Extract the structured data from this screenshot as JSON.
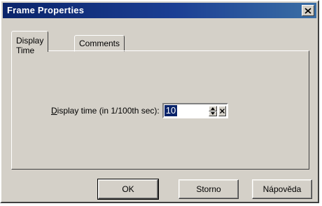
{
  "window": {
    "title": "Frame Properties"
  },
  "tabs": [
    {
      "label": "Display Time",
      "active": true
    },
    {
      "label": "Comments",
      "active": false
    }
  ],
  "display_time": {
    "label_mnemonic": "D",
    "label_rest": "isplay time (in 1/100th sec):",
    "value": "10"
  },
  "buttons": {
    "ok": "OK",
    "cancel": "Storno",
    "help": "Nápověda"
  },
  "colors": {
    "titlebar_start": "#0a246a",
    "titlebar_end": "#3a6ea5",
    "face": "#d4d0c8",
    "selection": "#0a246a"
  }
}
